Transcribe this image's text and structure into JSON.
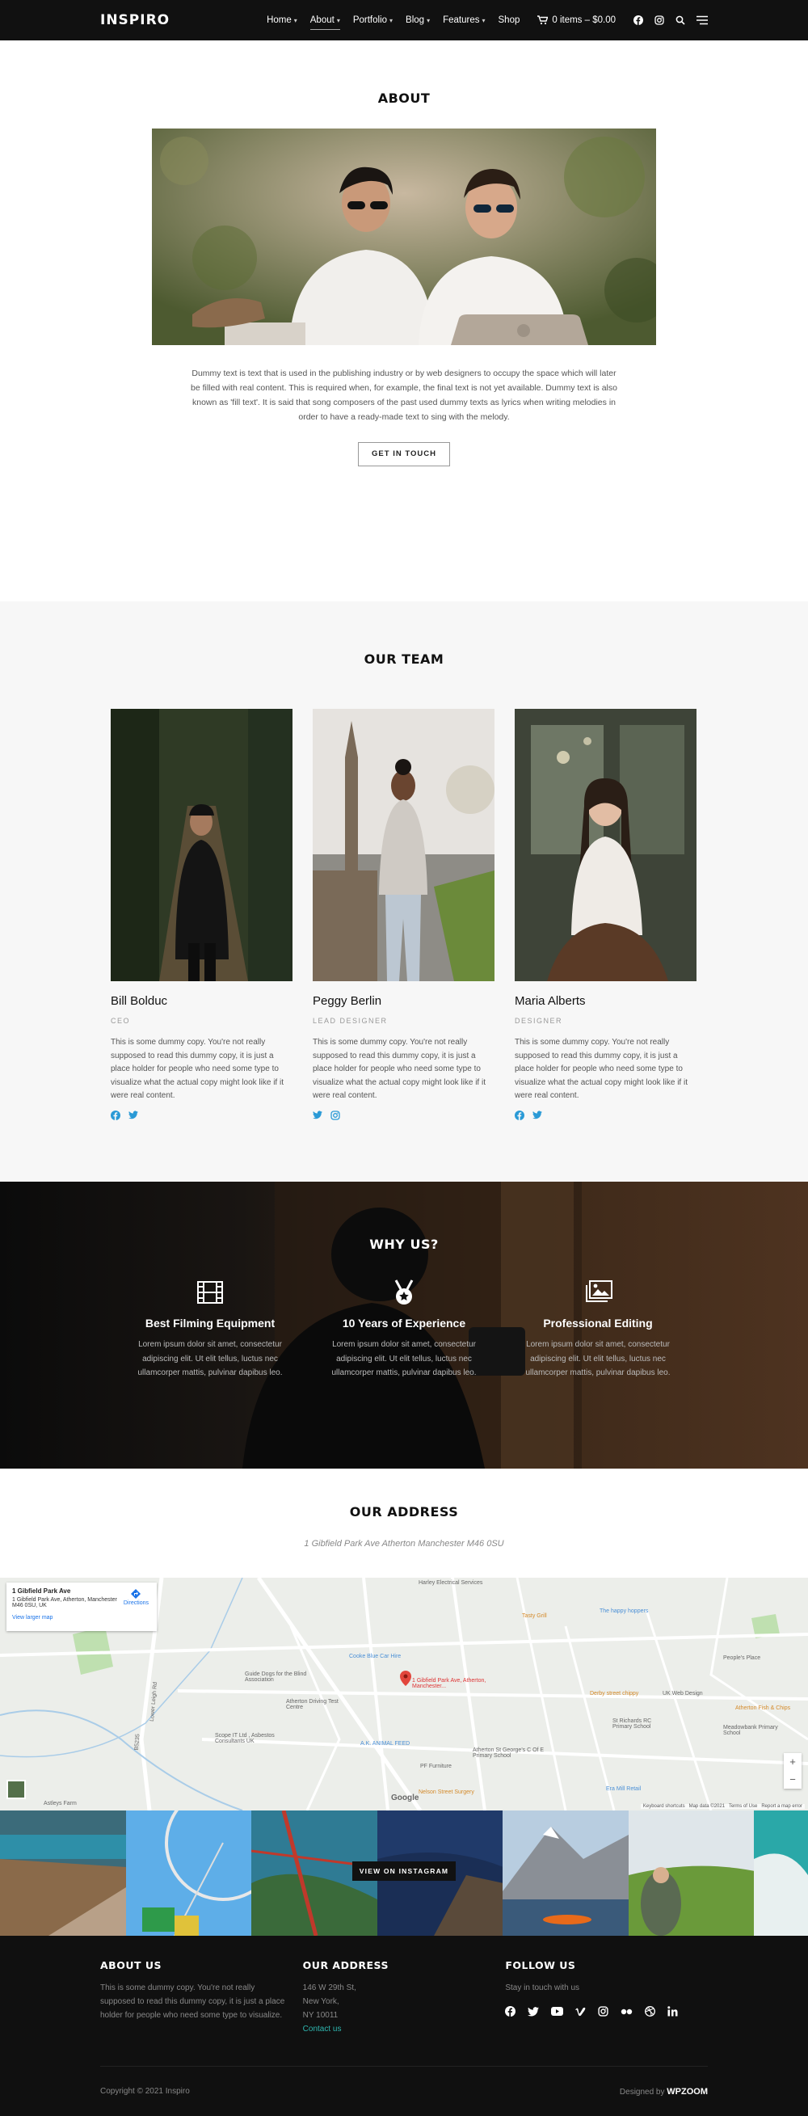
{
  "header": {
    "logo": "INSPIRO",
    "nav": [
      {
        "label": "Home",
        "caret": true
      },
      {
        "label": "About",
        "caret": true,
        "active": true
      },
      {
        "label": "Portfolio",
        "caret": true
      },
      {
        "label": "Blog",
        "caret": true
      },
      {
        "label": "Features",
        "caret": true
      },
      {
        "label": "Shop",
        "caret": false
      }
    ],
    "cart_label": "0 items – $0.00",
    "icons": [
      "facebook-icon",
      "instagram-icon",
      "search-icon",
      "menu-icon"
    ]
  },
  "about": {
    "title": "ABOUT",
    "description": "Dummy text is text that is used in the publishing industry or by web designers to occupy the space which will later be filled with real content. This is required when, for example, the final text is not yet available. Dummy text is also known as 'fill text'. It is said that song composers of the past used dummy texts as lyrics when writing melodies in order to have a ready-made text to sing with the melody.",
    "button": "GET IN TOUCH"
  },
  "team": {
    "title": "OUR TEAM",
    "members": [
      {
        "name": "Bill Bolduc",
        "role": "CEO",
        "bio": "This is some dummy copy. You're not really supposed to read this dummy copy, it is just a place holder for people who need some type to visualize what the actual copy might look like if it were real content.",
        "social": [
          "facebook-icon",
          "twitter-icon"
        ]
      },
      {
        "name": "Peggy Berlin",
        "role": "LEAD DESIGNER",
        "bio": "This is some dummy copy. You're not really supposed to read this dummy copy, it is just a place holder for people who need some type to visualize what the actual copy might look like if it were real content.",
        "social": [
          "twitter-icon",
          "instagram-icon"
        ]
      },
      {
        "name": "Maria Alberts",
        "role": "DESIGNER",
        "bio": "This is some dummy copy. You're not really supposed to read this dummy copy, it is just a place holder for people who need some type to visualize what the actual copy might look like if it were real content.",
        "social": [
          "facebook-icon",
          "twitter-icon"
        ]
      }
    ]
  },
  "why": {
    "title": "WHY US?",
    "features": [
      {
        "icon": "film-icon",
        "title": "Best Filming Equipment",
        "text": "Lorem ipsum dolor sit amet, consectetur adipiscing elit. Ut elit tellus, luctus nec ullamcorper mattis, pulvinar dapibus leo."
      },
      {
        "icon": "medal-icon",
        "title": "10 Years of Experience",
        "text": "Lorem ipsum dolor sit amet, consectetur adipiscing elit. Ut elit tellus, luctus nec ullamcorper mattis, pulvinar dapibus leo."
      },
      {
        "icon": "images-icon",
        "title": "Professional Editing",
        "text": "Lorem ipsum dolor sit amet, consectetur adipiscing elit. Ut elit tellus, luctus nec ullamcorper mattis, pulvinar dapibus leo."
      }
    ]
  },
  "address": {
    "title": "OUR ADDRESS",
    "line": "1 Gibfield Park Ave Atherton Manchester M46 0SU"
  },
  "map": {
    "card_title": "1 Gibfield Park Ave",
    "card_address": "1 Gibfield Park Ave, Atherton, Manchester M46 0SU, UK",
    "card_link": "View larger map",
    "directions": "Directions",
    "pin_label": "1 Gibfield Park Ave, Atherton, Manchester...",
    "places": [
      "Harley Electrical Services",
      "Tasty Grill",
      "The happy hoppers",
      "Cooke Blue Car Hire",
      "Guide Dogs for the Blind Association",
      "Atherton Driving Test Centre",
      "Scope IT Ltd , Asbestos Consultants UK",
      "A.K. ANIMAL FEED",
      "PF Furniture",
      "Nelson Street Surgery",
      "Atherton St George's C Of E Primary School",
      "Derby street chippy",
      "UK Web Design",
      "St Richards RC Primary School",
      "Atherton Fish & Chips",
      "Meadowbank Primary School",
      "Era Mill Retail",
      "People's Place",
      "Astleys Farm",
      "Lower Leigh Rd",
      "B5235"
    ],
    "google": "Google",
    "footer_links": [
      "Keyboard shortcuts",
      "Map data ©2021",
      "Terms of Use",
      "Report a map error"
    ]
  },
  "instagram": {
    "button": "VIEW ON INSTAGRAM"
  },
  "footer": {
    "about_title": "ABOUT US",
    "about_text": "This is some dummy copy. You're not really supposed to read this dummy copy, it is just a place holder for people who need some type to visualize.",
    "addr_title": "OUR ADDRESS",
    "addr_lines": [
      "146 W 29th St,",
      "New York,",
      "NY 10011"
    ],
    "contact": "Contact us",
    "follow_title": "FOLLOW US",
    "follow_text": "Stay in touch with us",
    "copyright": "Copyright © 2021 Inspiro",
    "designed_by": "Designed by",
    "designer": "WPZOOM"
  }
}
